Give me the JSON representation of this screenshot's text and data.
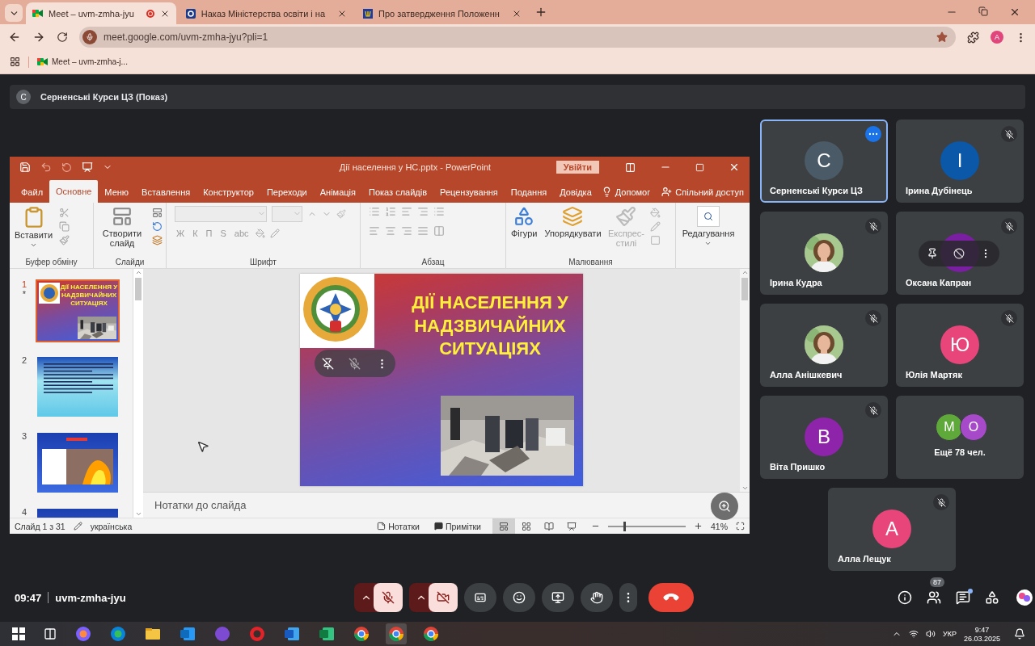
{
  "browser": {
    "tabs": [
      {
        "title": "Meet – uvm-zmha-jyu",
        "selected": true,
        "recording": true,
        "kind": "meet"
      },
      {
        "title": "Наказ Міністерства освіти і на",
        "selected": false,
        "recording": false,
        "kind": "doc"
      },
      {
        "title": "Про затвердження Положенн",
        "selected": false,
        "recording": false,
        "kind": "gov"
      }
    ],
    "address": "meet.google.com/uvm-zmha-jyu?pli=1",
    "bookmarked": true,
    "profile_initial": "A",
    "bookmarks": [
      {
        "title": "Meet – uvm-zmha-j..."
      }
    ]
  },
  "meet": {
    "presenter": {
      "initial": "С",
      "title": "Серненські Курси ЦЗ (Показ)"
    },
    "presentation": {
      "title": "Дії населення у НС.pptx  -  PowerPoint",
      "sign_in": "Увійти",
      "menu_tabs": [
        {
          "label": "Файл",
          "selected": false
        },
        {
          "label": "Основне",
          "selected": true
        },
        {
          "label": "Меню",
          "selected": false
        },
        {
          "label": "Вставлення",
          "selected": false
        },
        {
          "label": "Конструктор",
          "selected": false
        },
        {
          "label": "Переходи",
          "selected": false
        },
        {
          "label": "Анімація",
          "selected": false
        },
        {
          "label": "Показ слайдів",
          "selected": false
        },
        {
          "label": "Рецензування",
          "selected": false
        },
        {
          "label": "Подання",
          "selected": false
        },
        {
          "label": "Довідка",
          "selected": false
        }
      ],
      "tell_me": "Допомог",
      "share": "Спільний доступ",
      "clipboard": {
        "label": "Буфер обміну",
        "paste": "Вставити"
      },
      "slides": {
        "label": "Слайди",
        "new_slide": "Створити слайд"
      },
      "font": {
        "label": "Шрифт",
        "buttons": [
          "Ж",
          "К",
          "П",
          "S",
          "abc"
        ]
      },
      "paragraph": {
        "label": "Абзац"
      },
      "drawing": {
        "label": "Малювання",
        "shapes": "Фігури",
        "arrange": "Упорядкувати",
        "quick_styles": "Експрес-стилі",
        "quick_styles_disabled": true
      },
      "editing": "Редагування",
      "thumbnails": [
        {
          "number": "1",
          "note": "*",
          "selected": true,
          "kind": "title",
          "title": "ДІЇ НАСЕЛЕННЯ У НАДЗВИЧАЙНИХ СИТУАЦІЯХ"
        },
        {
          "number": "2",
          "selected": false,
          "kind": "text"
        },
        {
          "number": "3",
          "selected": false,
          "kind": "fire"
        },
        {
          "number": "4",
          "selected": false,
          "kind": "partial"
        }
      ],
      "slide": {
        "title": "ДІЇ НАСЕЛЕННЯ У НАДЗВИЧАЙНИХ СИТУАЦІЯХ"
      },
      "notes_placeholder": "Нотатки до слайда",
      "status": {
        "slide": "Слайд 1 з 31",
        "language": "українська",
        "notes": "Нотатки",
        "comments": "Примітки",
        "zoom": "41%"
      },
      "views": [
        {
          "selected": true
        },
        {
          "selected": false
        },
        {
          "selected": false
        },
        {
          "selected": false
        }
      ],
      "zoom_slider": {
        "level": 0.2
      }
    },
    "participants": [
      {
        "name": "Серненські Курси ЦЗ",
        "kind": "initial",
        "initial": "С",
        "color": "#4a5a66",
        "muted": false,
        "selected": true
      },
      {
        "name": "Ірина Дубінець",
        "kind": "initial",
        "initial": "І",
        "color": "#0b57a8",
        "muted": true,
        "selected": false
      },
      {
        "name": "Ірина Кудра",
        "muted": true,
        "selected": false
      },
      {
        "name": "Оксана Капран",
        "kind": "hovered",
        "color": "#7b1fa2",
        "muted": true,
        "selected": false
      },
      {
        "name": "Алла Анішкевич",
        "muted": true,
        "selected": false
      },
      {
        "name": "Юлія Мартяк",
        "kind": "initial",
        "initial": "Ю",
        "color": "#e8457a",
        "muted": true,
        "selected": false
      },
      {
        "name": "Віта Пришко",
        "kind": "initial",
        "initial": "В",
        "color": "#8e24aa",
        "muted": true,
        "selected": false
      },
      {
        "name": "Ещё 78 чел.",
        "kind": "more",
        "others": [
          {
            "initial": "М",
            "color": "#5fa83a"
          },
          {
            "initial": "О",
            "color": "#a64ac9"
          }
        ],
        "muted": false,
        "selected": false
      },
      {
        "name": "Алла Лещук",
        "kind": "initial",
        "initial": "А",
        "color": "#e8457a",
        "muted": true,
        "selected": false
      }
    ],
    "time": "09:47",
    "code": "uvm-zmha-jyu",
    "controls": {
      "mic_on": false,
      "camera_on": false
    },
    "people_count": "87",
    "chat_unread": true
  },
  "taskbar": {
    "language": "УКР",
    "time": "9:47",
    "date": "26.03.2025"
  }
}
